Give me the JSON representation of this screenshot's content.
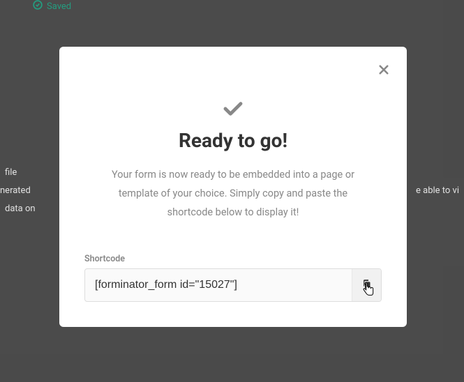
{
  "bg": {
    "saved_label": "Saved",
    "left1": "file",
    "left2": "nerated",
    "left3": "data on",
    "right1": "e able to vi"
  },
  "modal": {
    "title": "Ready to go!",
    "description": "Your form is now ready to be embedded into a page or template of your choice. Simply copy and paste the shortcode below to display it!",
    "field_label": "Shortcode",
    "shortcode_value": "[forminator_form id=\"15027\"]"
  },
  "icons": {
    "close": "close-icon",
    "check": "checkmark-icon",
    "copy": "copy-icon",
    "saved_check": "check-circle-icon"
  }
}
